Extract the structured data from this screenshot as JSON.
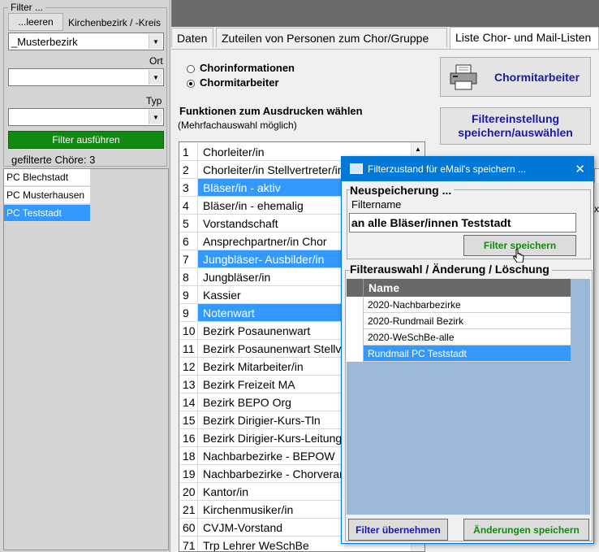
{
  "filter_panel": {
    "title": "Filter ...",
    "clear_button": "...leeren",
    "district_label": "Kirchenbezirk / -Kreis",
    "district_value": "_Musterbezirk",
    "ort_label": "Ort",
    "ort_value": "",
    "typ_label": "Typ",
    "typ_value": "",
    "run_filter_button": "Filter ausführen",
    "filtered_count": "gefilterte Chöre:  3",
    "choirs": [
      "PC Blechstadt",
      "PC Musterhausen",
      "PC Teststadt"
    ],
    "selected_choir": 2
  },
  "tabs": [
    {
      "label": "Daten"
    },
    {
      "label": "Zuteilen von Personen zum Chor/Gruppe"
    },
    {
      "label": "Liste Chor- und Mail-Listen"
    }
  ],
  "radio": {
    "option1": "Chorinformationen",
    "option2": "Chormitarbeiter",
    "selected": 2
  },
  "print_button_label": "Chormitarbeiter",
  "filter_settings_button": {
    "line1": "Filtereinstellung",
    "line2": "speichern/auswählen"
  },
  "functions_heading": "Funktionen zum Ausdrucken wählen",
  "functions_subheading": "(Mehrfachauswahl möglich)",
  "functions": [
    {
      "num": "1",
      "name": "Chorleiter/in",
      "sel": false
    },
    {
      "num": "2",
      "name": "Chorleiter/in  Stellvertreter/in",
      "sel": false
    },
    {
      "num": "3",
      "name": "Bläser/in - aktiv",
      "sel": true
    },
    {
      "num": "4",
      "name": "Bläser/in - ehemalig",
      "sel": false
    },
    {
      "num": "5",
      "name": "Vorstandschaft",
      "sel": false
    },
    {
      "num": "6",
      "name": "Ansprechpartner/in Chor",
      "sel": false
    },
    {
      "num": "7",
      "name": "Jungbläser- Ausbilder/in",
      "sel": true
    },
    {
      "num": "8",
      "name": "Jungbläser/in",
      "sel": false
    },
    {
      "num": "9",
      "name": "Kassier",
      "sel": false
    },
    {
      "num": "9",
      "name": "Notenwart",
      "sel": true
    },
    {
      "num": "10",
      "name": "Bezirk Posaunenwart",
      "sel": false
    },
    {
      "num": "11",
      "name": "Bezirk Posaunenwart  Stellv.",
      "sel": false
    },
    {
      "num": "12",
      "name": "Bezirk Mitarbeiter/in",
      "sel": false
    },
    {
      "num": "13",
      "name": "Bezirk Freizeit MA",
      "sel": false
    },
    {
      "num": "14",
      "name": "Bezirk BEPO Org",
      "sel": false
    },
    {
      "num": "15",
      "name": "Bezirk Dirigier-Kurs-Tln",
      "sel": false
    },
    {
      "num": "16",
      "name": "Bezirk Dirigier-Kurs-Leitung",
      "sel": false
    },
    {
      "num": "18",
      "name": "Nachbarbezirke - BEPOW",
      "sel": false
    },
    {
      "num": "19",
      "name": "Nachbarbezirke - Chorverantw.",
      "sel": false
    },
    {
      "num": "20",
      "name": "Kantor/in",
      "sel": false
    },
    {
      "num": "21",
      "name": "Kirchenmusiker/in",
      "sel": false
    },
    {
      "num": "60",
      "name": "CVJM-Vorstand",
      "sel": false
    },
    {
      "num": "71",
      "name": "Trp Lehrer WeSchBe",
      "sel": false
    }
  ],
  "dialog": {
    "title": "Filterzustand  für eMail's speichern ...",
    "close": "✕",
    "new_group": "Neuspeicherung ...",
    "filtername_label": "Filtername",
    "filtername_value": "an alle Bläser/innen Teststadt",
    "save_button": "Filter speichern",
    "select_group": "Filterauswahl / Änderung / Löschung",
    "grid_header": "Name",
    "grid_rows": [
      "2020-Nachbarbezirke",
      "2020-Rundmail Bezirk",
      "2020-WeSchBe-alle",
      "Rundmail PC Teststadt"
    ],
    "grid_selected": 3,
    "apply_button": "Filter übernehmen",
    "save_changes_button": "Änderungen speichern"
  },
  "colors": {
    "selection": "#3399ff",
    "green_button": "#128a12",
    "dialog_title": "#0078d7",
    "grid_bg": "#9ab8d8",
    "link_blue": "#1a1aa6",
    "dark_header": "#696969"
  }
}
